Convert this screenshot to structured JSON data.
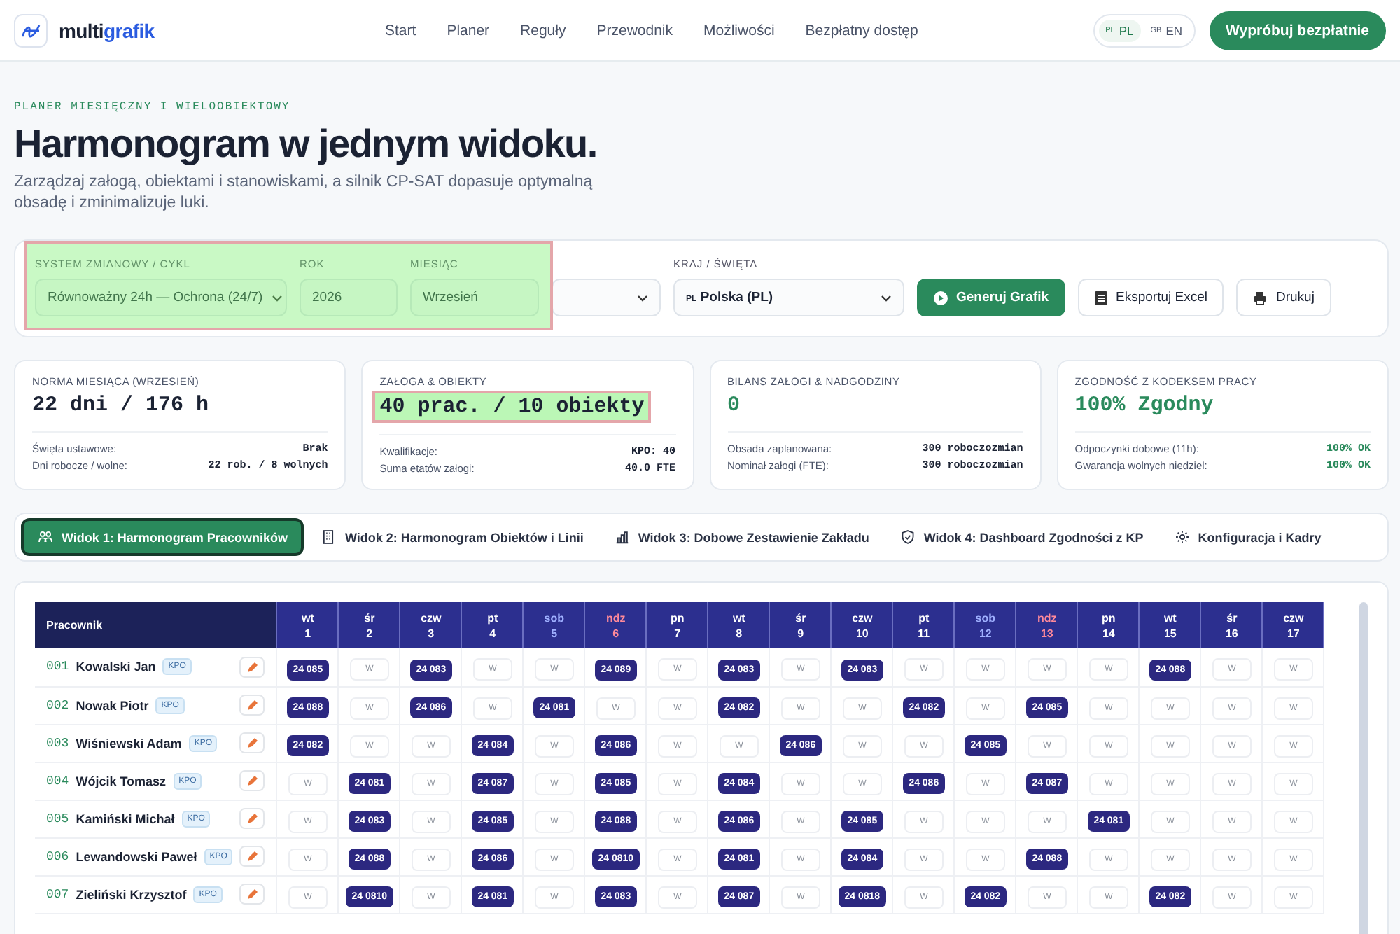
{
  "header": {
    "logo": "multi",
    "logo_accent": "grafik",
    "nav": [
      "Start",
      "Planer",
      "Reguły",
      "Przewodnik",
      "Możliwości",
      "Bezpłatny dostęp"
    ],
    "languages": [
      {
        "flag": "PL",
        "label": "PL",
        "selected": true
      },
      {
        "flag": "GB",
        "label": "EN",
        "selected": false
      }
    ],
    "cta": "Wypróbuj bezpłatnie"
  },
  "hero": {
    "eyebrow": "PLANER MIESIĘCZNY I WIELOOBIEKTOWY",
    "title": "Harmonogram w jednym widoku.",
    "subtitle": "Zarządzaj załogą, obiektami i stanowiskami, a silnik CP-SAT dopasuje optymalną obsadę i zminimalizuje luki."
  },
  "settings": {
    "highlighted": true,
    "fields": [
      {
        "label": "SYSTEM ZMIANOWY / CYKL",
        "value": "Równoważny 24h — Ochrona (24/7)",
        "kind": "select"
      },
      {
        "label": "ROK",
        "value": "2026",
        "kind": "input"
      },
      {
        "label": "MIESIĄC",
        "value": "Wrzesień",
        "kind": "input"
      },
      {
        "kind": "select"
      },
      {
        "label": "KRAJ / ŚWIĘTA",
        "flag": "PL",
        "value": "Polska (PL)",
        "kind": "select"
      }
    ],
    "buttons": [
      {
        "label": "Generuj Grafik",
        "kind": "primary"
      },
      {
        "label": "Eksportuj Excel",
        "kind": "secondary"
      },
      {
        "label": "Drukuj",
        "kind": "secondary"
      }
    ]
  },
  "cards": [
    {
      "title": "NORMA MIESIĄCA (WRZESIEŃ)",
      "value": "22 dni / 176 h",
      "kind": "neutral",
      "highlighted": false,
      "rows": [
        {
          "label": "Święta ustawowe:",
          "value": "Brak",
          "kind": "neutral"
        },
        {
          "label": "Dni robocze / wolne:",
          "value": "22 rob. / 8 wolnych",
          "kind": "neutral"
        }
      ]
    },
    {
      "title": "ZAŁOGA & OBIEKTY",
      "value": "40 prac. / 10 obiekty",
      "kind": "neutral",
      "highlighted": true,
      "rows": [
        {
          "label": "Kwalifikacje:",
          "value": "KPO: 40",
          "kind": "neutral"
        },
        {
          "label": "Suma etatów załogi:",
          "value": "40.0 FTE",
          "kind": "neutral"
        }
      ]
    },
    {
      "title": "BILANS ZAŁOGI & NADGODZINY",
      "value": "0",
      "kind": "positive",
      "highlighted": false,
      "rows": [
        {
          "label": "Obsada zaplanowana:",
          "value": "300 roboczozmian",
          "kind": "neutral"
        },
        {
          "label": "Nominał załogi (FTE):",
          "value": "300 roboczozmian",
          "kind": "neutral"
        }
      ]
    },
    {
      "title": "ZGODNOŚĆ Z KODEKSEM PRACY",
      "value": "100% Zgodny",
      "kind": "positive",
      "highlighted": false,
      "rows": [
        {
          "label": "Odpoczynki dobowe (11h):",
          "value": "100% OK",
          "kind": "positive"
        },
        {
          "label": "Gwarancja wolnych niedziel:",
          "value": "100% OK",
          "kind": "positive"
        }
      ]
    }
  ],
  "tabs": [
    {
      "label": "Widok 1: Harmonogram Pracowników",
      "selected": true
    },
    {
      "label": "Widok 2: Harmonogram Obiektów i Linii",
      "selected": false
    },
    {
      "label": "Widok 3: Dobowe Zestawienie Zakładu",
      "selected": false
    },
    {
      "label": "Widok 4: Dashboard Zgodności z KP",
      "selected": false
    },
    {
      "label": "Konfiguracja i Kadry",
      "selected": false
    }
  ],
  "table": {
    "name_column": "Pracownik",
    "days": [
      {
        "dow": "wt",
        "day": "1",
        "kind": "weekday"
      },
      {
        "dow": "śr",
        "day": "2",
        "kind": "weekday"
      },
      {
        "dow": "czw",
        "day": "3",
        "kind": "weekday"
      },
      {
        "dow": "pt",
        "day": "4",
        "kind": "weekday"
      },
      {
        "dow": "sob",
        "day": "5",
        "kind": "saturday"
      },
      {
        "dow": "ndz",
        "day": "6",
        "kind": "sunday"
      },
      {
        "dow": "pn",
        "day": "7",
        "kind": "weekday"
      },
      {
        "dow": "wt",
        "day": "8",
        "kind": "weekday"
      },
      {
        "dow": "śr",
        "day": "9",
        "kind": "weekday"
      },
      {
        "dow": "czw",
        "day": "10",
        "kind": "weekday"
      },
      {
        "dow": "pt",
        "day": "11",
        "kind": "weekday"
      },
      {
        "dow": "sob",
        "day": "12",
        "kind": "saturday"
      },
      {
        "dow": "ndz",
        "day": "13",
        "kind": "sunday"
      },
      {
        "dow": "pn",
        "day": "14",
        "kind": "weekday"
      },
      {
        "dow": "wt",
        "day": "15",
        "kind": "weekday"
      },
      {
        "dow": "śr",
        "day": "16",
        "kind": "weekday"
      },
      {
        "dow": "czw",
        "day": "17",
        "kind": "weekday"
      }
    ],
    "rows": [
      {
        "id": "001",
        "name": "Kowalski Jan",
        "tag": "KPO",
        "cells": [
          {
            "text": "24 085",
            "kind": "shift"
          },
          {
            "text": "W",
            "kind": "off"
          },
          {
            "text": "24 083",
            "kind": "shift"
          },
          {
            "text": "W",
            "kind": "off"
          },
          {
            "text": "W",
            "kind": "off"
          },
          {
            "text": "24 089",
            "kind": "shift"
          },
          {
            "text": "W",
            "kind": "off"
          },
          {
            "text": "24 083",
            "kind": "shift"
          },
          {
            "text": "W",
            "kind": "off"
          },
          {
            "text": "24 083",
            "kind": "shift"
          },
          {
            "text": "W",
            "kind": "off"
          },
          {
            "text": "W",
            "kind": "off"
          },
          {
            "text": "W",
            "kind": "off"
          },
          {
            "text": "W",
            "kind": "off"
          },
          {
            "text": "24 088",
            "kind": "shift"
          },
          {
            "text": "W",
            "kind": "off"
          },
          {
            "text": "W",
            "kind": "off"
          }
        ]
      },
      {
        "id": "002",
        "name": "Nowak Piotr",
        "tag": "KPO",
        "cells": [
          {
            "text": "24 088",
            "kind": "shift"
          },
          {
            "text": "W",
            "kind": "off"
          },
          {
            "text": "24 086",
            "kind": "shift"
          },
          {
            "text": "W",
            "kind": "off"
          },
          {
            "text": "24 081",
            "kind": "shift"
          },
          {
            "text": "W",
            "kind": "off"
          },
          {
            "text": "W",
            "kind": "off"
          },
          {
            "text": "24 082",
            "kind": "shift"
          },
          {
            "text": "W",
            "kind": "off"
          },
          {
            "text": "W",
            "kind": "off"
          },
          {
            "text": "24 082",
            "kind": "shift"
          },
          {
            "text": "W",
            "kind": "off"
          },
          {
            "text": "24 085",
            "kind": "shift"
          },
          {
            "text": "W",
            "kind": "off"
          },
          {
            "text": "W",
            "kind": "off"
          },
          {
            "text": "W",
            "kind": "off"
          },
          {
            "text": "W",
            "kind": "off"
          }
        ]
      },
      {
        "id": "003",
        "name": "Wiśniewski Adam",
        "tag": "KPO",
        "cells": [
          {
            "text": "24 082",
            "kind": "shift"
          },
          {
            "text": "W",
            "kind": "off"
          },
          {
            "text": "W",
            "kind": "off"
          },
          {
            "text": "24 084",
            "kind": "shift"
          },
          {
            "text": "W",
            "kind": "off"
          },
          {
            "text": "24 086",
            "kind": "shift"
          },
          {
            "text": "W",
            "kind": "off"
          },
          {
            "text": "W",
            "kind": "off"
          },
          {
            "text": "24 086",
            "kind": "shift"
          },
          {
            "text": "W",
            "kind": "off"
          },
          {
            "text": "W",
            "kind": "off"
          },
          {
            "text": "24 085",
            "kind": "shift"
          },
          {
            "text": "W",
            "kind": "off"
          },
          {
            "text": "W",
            "kind": "off"
          },
          {
            "text": "W",
            "kind": "off"
          },
          {
            "text": "W",
            "kind": "off"
          },
          {
            "text": "W",
            "kind": "off"
          }
        ]
      },
      {
        "id": "004",
        "name": "Wójcik Tomasz",
        "tag": "KPO",
        "cells": [
          {
            "text": "W",
            "kind": "off"
          },
          {
            "text": "24 081",
            "kind": "shift"
          },
          {
            "text": "W",
            "kind": "off"
          },
          {
            "text": "24 087",
            "kind": "shift"
          },
          {
            "text": "W",
            "kind": "off"
          },
          {
            "text": "24 085",
            "kind": "shift"
          },
          {
            "text": "W",
            "kind": "off"
          },
          {
            "text": "24 084",
            "kind": "shift"
          },
          {
            "text": "W",
            "kind": "off"
          },
          {
            "text": "W",
            "kind": "off"
          },
          {
            "text": "24 086",
            "kind": "shift"
          },
          {
            "text": "W",
            "kind": "off"
          },
          {
            "text": "24 087",
            "kind": "shift"
          },
          {
            "text": "W",
            "kind": "off"
          },
          {
            "text": "W",
            "kind": "off"
          },
          {
            "text": "W",
            "kind": "off"
          },
          {
            "text": "W",
            "kind": "off"
          }
        ]
      },
      {
        "id": "005",
        "name": "Kamiński Michał",
        "tag": "KPO",
        "cells": [
          {
            "text": "W",
            "kind": "off"
          },
          {
            "text": "24 083",
            "kind": "shift"
          },
          {
            "text": "W",
            "kind": "off"
          },
          {
            "text": "24 085",
            "kind": "shift"
          },
          {
            "text": "W",
            "kind": "off"
          },
          {
            "text": "24 088",
            "kind": "shift"
          },
          {
            "text": "W",
            "kind": "off"
          },
          {
            "text": "24 086",
            "kind": "shift"
          },
          {
            "text": "W",
            "kind": "off"
          },
          {
            "text": "24 085",
            "kind": "shift"
          },
          {
            "text": "W",
            "kind": "off"
          },
          {
            "text": "W",
            "kind": "off"
          },
          {
            "text": "W",
            "kind": "off"
          },
          {
            "text": "24 081",
            "kind": "shift"
          },
          {
            "text": "W",
            "kind": "off"
          },
          {
            "text": "W",
            "kind": "off"
          },
          {
            "text": "W",
            "kind": "off"
          }
        ]
      },
      {
        "id": "006",
        "name": "Lewandowski Paweł",
        "tag": "KPO",
        "cells": [
          {
            "text": "W",
            "kind": "off"
          },
          {
            "text": "24 088",
            "kind": "shift"
          },
          {
            "text": "W",
            "kind": "off"
          },
          {
            "text": "24 086",
            "kind": "shift"
          },
          {
            "text": "W",
            "kind": "off"
          },
          {
            "text": "24 0810",
            "kind": "shift"
          },
          {
            "text": "W",
            "kind": "off"
          },
          {
            "text": "24 081",
            "kind": "shift"
          },
          {
            "text": "W",
            "kind": "off"
          },
          {
            "text": "24 084",
            "kind": "shift"
          },
          {
            "text": "W",
            "kind": "off"
          },
          {
            "text": "W",
            "kind": "off"
          },
          {
            "text": "24 088",
            "kind": "shift"
          },
          {
            "text": "W",
            "kind": "off"
          },
          {
            "text": "W",
            "kind": "off"
          },
          {
            "text": "W",
            "kind": "off"
          },
          {
            "text": "W",
            "kind": "off"
          }
        ]
      },
      {
        "id": "007",
        "name": "Zieliński Krzysztof",
        "tag": "KPO",
        "cells": [
          {
            "text": "W",
            "kind": "off"
          },
          {
            "text": "24 0810",
            "kind": "shift"
          },
          {
            "text": "W",
            "kind": "off"
          },
          {
            "text": "24 081",
            "kind": "shift"
          },
          {
            "text": "W",
            "kind": "off"
          },
          {
            "text": "24 083",
            "kind": "shift"
          },
          {
            "text": "W",
            "kind": "off"
          },
          {
            "text": "24 087",
            "kind": "shift"
          },
          {
            "text": "W",
            "kind": "off"
          },
          {
            "text": "24 0818",
            "kind": "shift"
          },
          {
            "text": "W",
            "kind": "off"
          },
          {
            "text": "24 082",
            "kind": "shift"
          },
          {
            "text": "W",
            "kind": "off"
          },
          {
            "text": "W",
            "kind": "off"
          },
          {
            "text": "24 082",
            "kind": "shift"
          },
          {
            "text": "W",
            "kind": "off"
          },
          {
            "text": "W",
            "kind": "off"
          }
        ]
      }
    ]
  }
}
